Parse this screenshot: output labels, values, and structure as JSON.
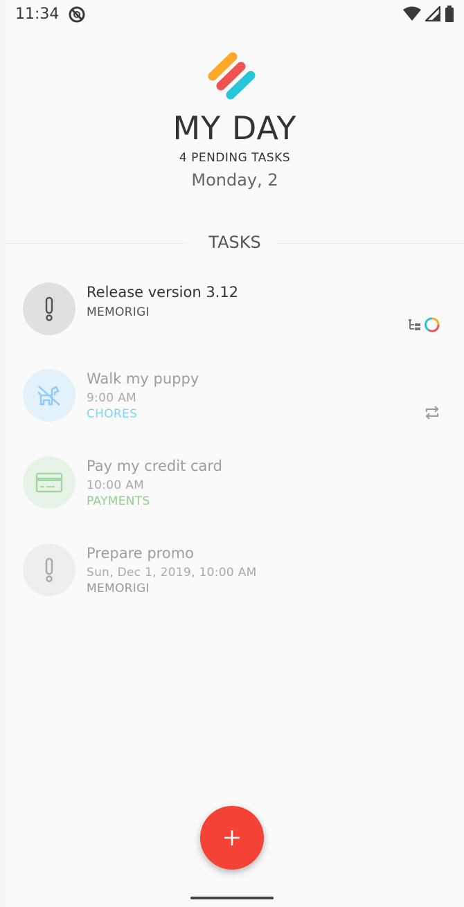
{
  "status_bar": {
    "time": "11:34"
  },
  "header": {
    "title": "MY DAY",
    "pending": "4 PENDING TASKS",
    "date": "Monday, 2"
  },
  "section": {
    "label": "TASKS"
  },
  "tasks": [
    {
      "name": "Release version 3.12",
      "line1": "MEMORIGI",
      "line2": "",
      "icon": "exclamation-icon",
      "avatar_color": "#e0e0e0",
      "name_color": "#333333",
      "line1_color": "#555555",
      "line2_color": "#555555"
    },
    {
      "name": "Walk my puppy",
      "line1": "9:00 AM",
      "line2": "CHORES",
      "icon": "dog-icon",
      "avatar_color": "#e3f2fa",
      "name_color": "#9e9e9e",
      "line1_color": "#aaaaaa",
      "line2_color": "#81d4fa"
    },
    {
      "name": "Pay my credit card",
      "line1": "10:00 AM",
      "line2": "PAYMENTS",
      "icon": "credit-card-icon",
      "avatar_color": "#e8f3e8",
      "name_color": "#9e9e9e",
      "line1_color": "#aaaaaa",
      "line2_color": "#8fd08f"
    },
    {
      "name": "Prepare promo",
      "line1": "Sun, Dec 1, 2019, 10:00 AM",
      "line2": "MEMORIGI",
      "icon": "exclamation-icon",
      "avatar_color": "#eeeeee",
      "name_color": "#9e9e9e",
      "line1_color": "#aaaaaa",
      "line2_color": "#999999"
    }
  ],
  "colors": {
    "accent": "#f44336",
    "logo": [
      "#ffa726",
      "#ef5350",
      "#26c6da"
    ]
  }
}
